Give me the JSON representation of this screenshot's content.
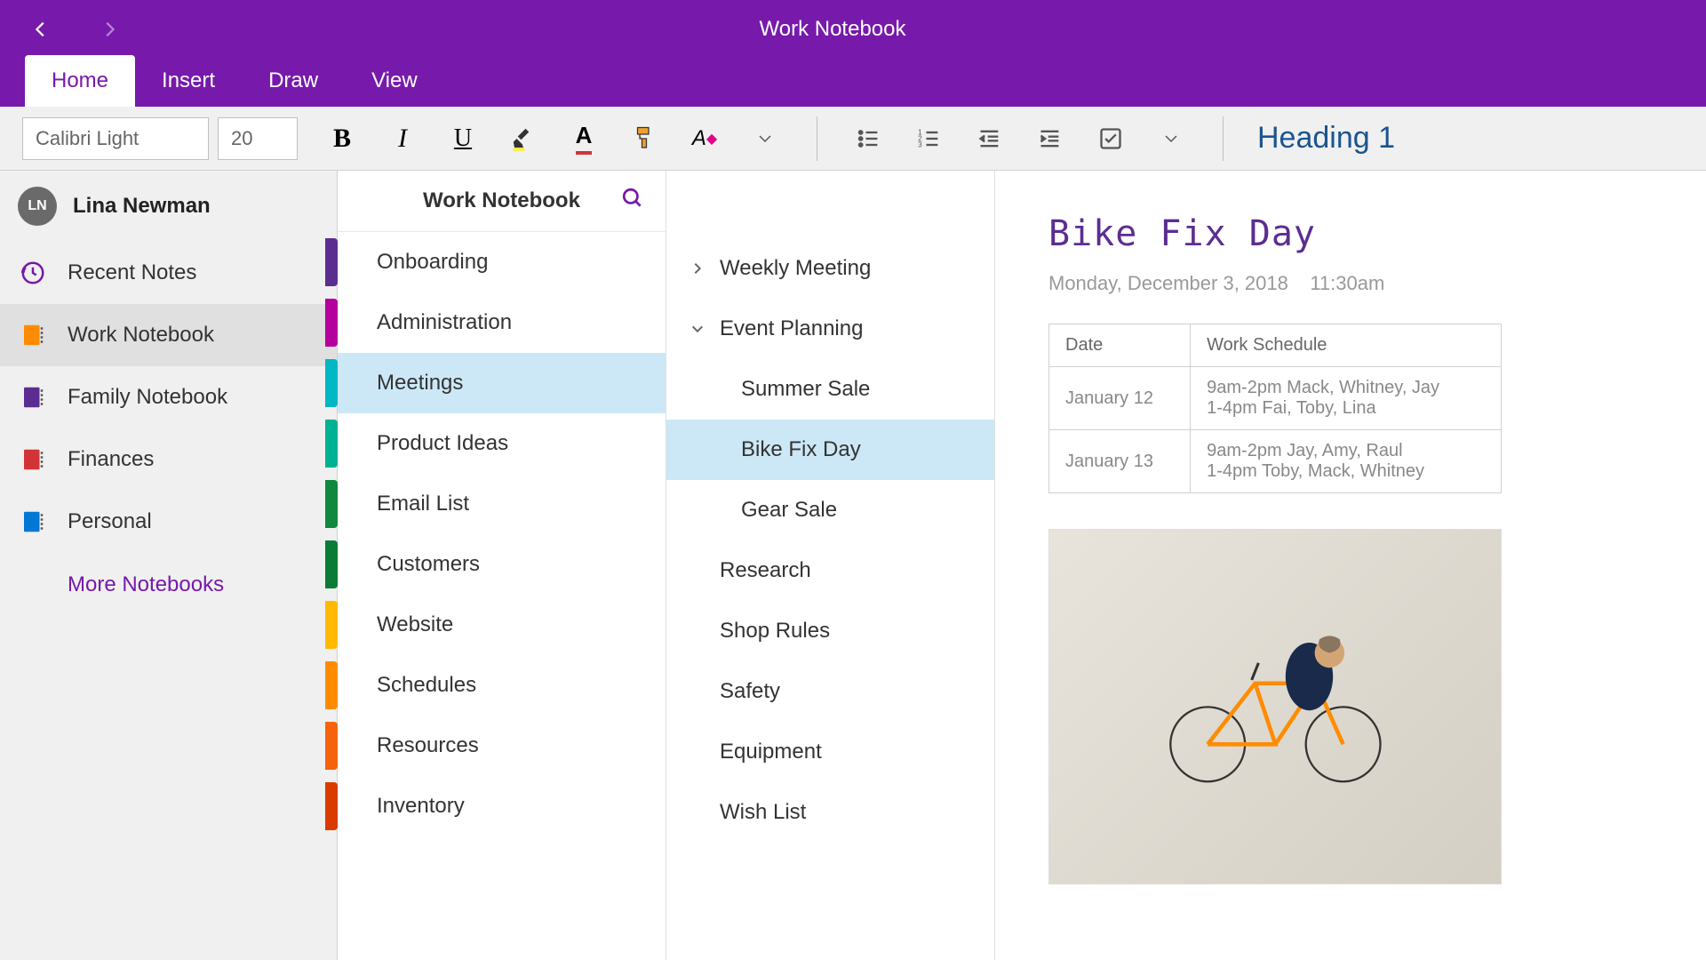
{
  "window": {
    "title": "Work Notebook"
  },
  "tabs": [
    {
      "label": "Home",
      "active": true
    },
    {
      "label": "Insert",
      "active": false
    },
    {
      "label": "Draw",
      "active": false
    },
    {
      "label": "View",
      "active": false
    }
  ],
  "toolbar": {
    "font_name": "Calibri Light",
    "font_size": "20",
    "style_label": "Heading 1"
  },
  "user": {
    "initials": "LN",
    "name": "Lina Newman"
  },
  "nav": {
    "recent": "Recent Notes",
    "notebooks": [
      {
        "label": "Work Notebook",
        "color": "#ff8c00",
        "selected": true
      },
      {
        "label": "Family Notebook",
        "color": "#5c2d91",
        "selected": false
      },
      {
        "label": "Finances",
        "color": "#d13438",
        "selected": false
      },
      {
        "label": "Personal",
        "color": "#0078d4",
        "selected": false
      }
    ],
    "more": "More Notebooks"
  },
  "sections": {
    "header": "Work Notebook",
    "items": [
      {
        "label": "Onboarding",
        "color": "#5c2d91",
        "selected": false
      },
      {
        "label": "Administration",
        "color": "#b4009e",
        "selected": false
      },
      {
        "label": "Meetings",
        "color": "#00b7c3",
        "selected": true
      },
      {
        "label": "Product Ideas",
        "color": "#00b294",
        "selected": false
      },
      {
        "label": "Email List",
        "color": "#10893e",
        "selected": false
      },
      {
        "label": "Customers",
        "color": "#0a7c36",
        "selected": false
      },
      {
        "label": "Website",
        "color": "#ffb900",
        "selected": false
      },
      {
        "label": "Schedules",
        "color": "#ff8c00",
        "selected": false
      },
      {
        "label": "Resources",
        "color": "#f7630c",
        "selected": false
      },
      {
        "label": "Inventory",
        "color": "#da3b01",
        "selected": false
      }
    ]
  },
  "pages": [
    {
      "label": "Weekly Meeting",
      "expand": "right",
      "indent": 0,
      "selected": false
    },
    {
      "label": "Event Planning",
      "expand": "down",
      "indent": 0,
      "selected": false
    },
    {
      "label": "Summer Sale",
      "expand": "",
      "indent": 1,
      "selected": false
    },
    {
      "label": "Bike Fix Day",
      "expand": "",
      "indent": 1,
      "selected": true
    },
    {
      "label": "Gear Sale",
      "expand": "",
      "indent": 1,
      "selected": false
    },
    {
      "label": "Research",
      "expand": "",
      "indent": 0,
      "selected": false
    },
    {
      "label": "Shop Rules",
      "expand": "",
      "indent": 0,
      "selected": false
    },
    {
      "label": "Safety",
      "expand": "",
      "indent": 0,
      "selected": false
    },
    {
      "label": "Equipment",
      "expand": "",
      "indent": 0,
      "selected": false
    },
    {
      "label": "Wish List",
      "expand": "",
      "indent": 0,
      "selected": false
    }
  ],
  "content": {
    "title": "Bike Fix Day",
    "date": "Monday, December 3, 2018",
    "time": "11:30am",
    "table": {
      "headers": [
        "Date",
        "Work Schedule"
      ],
      "rows": [
        [
          "January 12",
          "9am-2pm Mack, Whitney, Jay\n1-4pm Fai, Toby, Lina"
        ],
        [
          "January 13",
          "9am-2pm Jay, Amy, Raul\n1-4pm Toby, Mack, Whitney"
        ]
      ]
    }
  }
}
